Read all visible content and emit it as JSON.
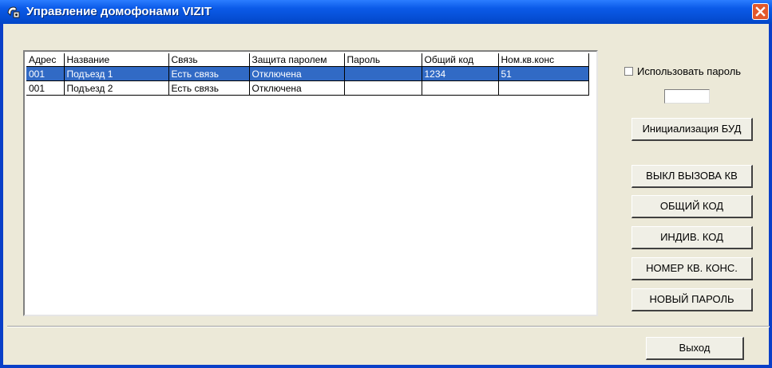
{
  "window": {
    "title": "Управление домофонами VIZIT"
  },
  "grid": {
    "columns": [
      "Адрес",
      "Название",
      "Связь",
      "Защита паролем",
      "Пароль",
      "Общий код",
      "Ном.кв.конс"
    ],
    "rows": [
      [
        "001",
        "Подъезд 1",
        "Есть связь",
        "Отключена",
        "",
        "1234",
        "51"
      ],
      [
        "001",
        "Подъезд 2",
        "Есть связь",
        "Отключена",
        "",
        "",
        ""
      ]
    ],
    "selected_row": 0
  },
  "password": {
    "checkbox_label": "Использовать пароль",
    "checked": false,
    "value": ""
  },
  "buttons": {
    "init": "Инициализация БУД",
    "call_off": "ВЫКЛ ВЫЗОВА КВ",
    "common_code": "ОБЩИЙ КОД",
    "indiv_code": "ИНДИВ. КОД",
    "concierge_no": "НОМЕР КВ. КОНС.",
    "new_password": "НОВЫЙ ПАРОЛЬ",
    "exit": "Выход"
  },
  "colors": {
    "titlebar": "#0b5ae8",
    "selection": "#316ac5",
    "window_bg": "#ece9d8",
    "close": "#e2582c"
  }
}
